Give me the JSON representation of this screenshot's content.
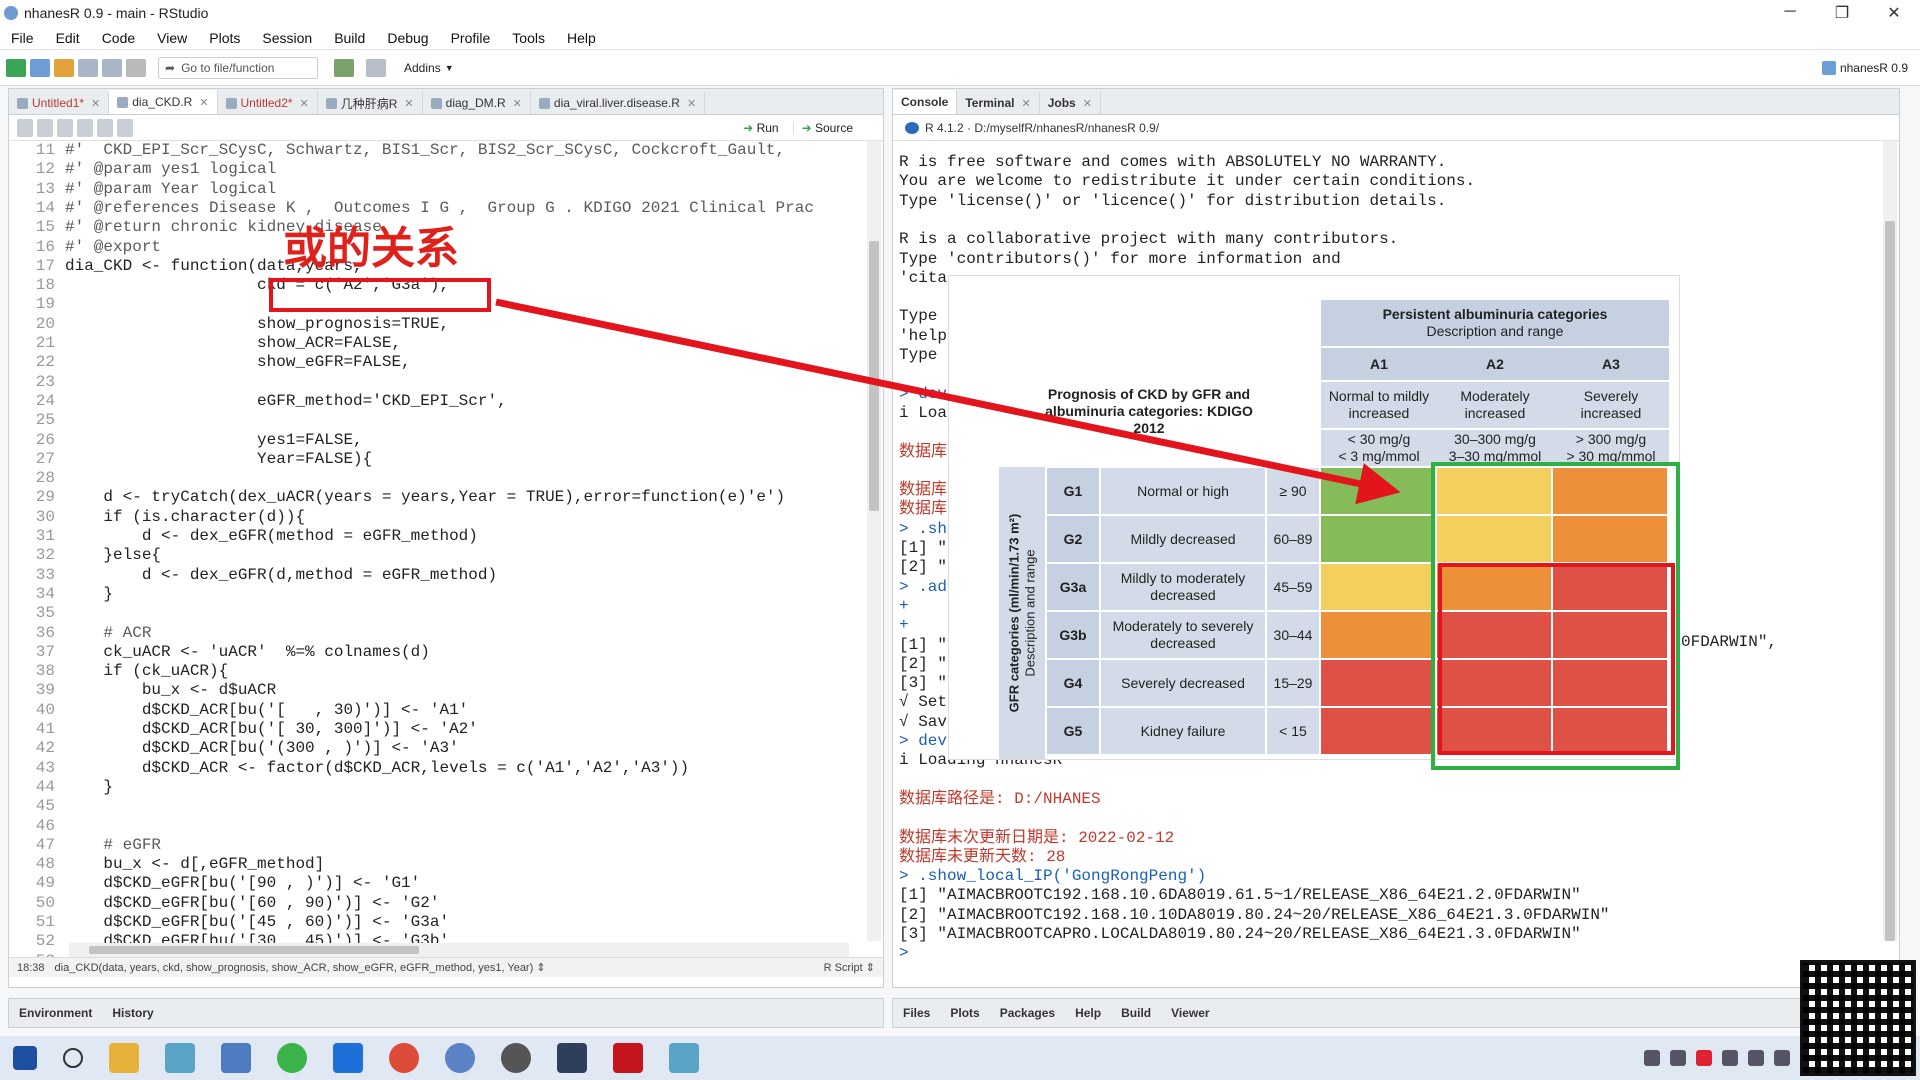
{
  "window": {
    "title": "nhanesR 0.9 - main - RStudio",
    "controls": [
      "─",
      "❐",
      "✕"
    ]
  },
  "menu": [
    "File",
    "Edit",
    "Code",
    "View",
    "Plots",
    "Session",
    "Build",
    "Debug",
    "Profile",
    "Tools",
    "Help"
  ],
  "toolbar": {
    "goto_placeholder": "Go to file/function",
    "addins": "Addins",
    "project": "nhanesR 0.9"
  },
  "editor": {
    "tabs": [
      {
        "label": "Untitled1*",
        "modified": true
      },
      {
        "label": "dia_CKD.R",
        "active": true
      },
      {
        "label": "Untitled2*",
        "modified": true
      },
      {
        "label": "几种肝病R"
      },
      {
        "label": "diag_DM.R"
      },
      {
        "label": "dia_viral.liver.disease.R"
      }
    ],
    "run_label": "Run",
    "source_label": "Source",
    "lines": [
      [
        "11",
        "#'  CKD_EPI_Scr_SCysC, Schwartz, BIS1_Scr, BIS2_Scr_SCysC, Cockcroft_Gault,"
      ],
      [
        "12",
        "#' @param yes1 logical"
      ],
      [
        "13",
        "#' @param Year logical"
      ],
      [
        "14",
        "#' @references Disease K ,  Outcomes I G ,  Group G . KDIGO 2021 Clinical Prac"
      ],
      [
        "15",
        "#' @return chronic kidney disease"
      ],
      [
        "16",
        "#' @export"
      ],
      [
        "17",
        "dia_CKD <- function(data,years,"
      ],
      [
        "18",
        "                    ckd = c('A2','G3a'),"
      ],
      [
        "19",
        ""
      ],
      [
        "20",
        "                    show_prognosis=TRUE,"
      ],
      [
        "21",
        "                    show_ACR=FALSE,"
      ],
      [
        "22",
        "                    show_eGFR=FALSE,"
      ],
      [
        "23",
        ""
      ],
      [
        "24",
        "                    eGFR_method='CKD_EPI_Scr',"
      ],
      [
        "25",
        ""
      ],
      [
        "26",
        "                    yes1=FALSE,"
      ],
      [
        "27",
        "                    Year=FALSE){"
      ],
      [
        "28",
        ""
      ],
      [
        "29",
        "    d <- tryCatch(dex_uACR(years = years,Year = TRUE),error=function(e)'e')"
      ],
      [
        "30",
        "    if (is.character(d)){"
      ],
      [
        "31",
        "        d <- dex_eGFR(method = eGFR_method)"
      ],
      [
        "32",
        "    }else{"
      ],
      [
        "33",
        "        d <- dex_eGFR(d,method = eGFR_method)"
      ],
      [
        "34",
        "    }"
      ],
      [
        "35",
        ""
      ],
      [
        "36",
        "    # ACR"
      ],
      [
        "37",
        "    ck_uACR <- 'uACR'  %=% colnames(d)"
      ],
      [
        "38",
        "    if (ck_uACR){"
      ],
      [
        "39",
        "        bu_x <- d$uACR"
      ],
      [
        "40",
        "        d$CKD_ACR[bu('[   , 30)')] <- 'A1'"
      ],
      [
        "41",
        "        d$CKD_ACR[bu('[ 30, 300]')] <- 'A2'"
      ],
      [
        "42",
        "        d$CKD_ACR[bu('(300 , )')] <- 'A3'"
      ],
      [
        "43",
        "        d$CKD_ACR <- factor(d$CKD_ACR,levels = c('A1','A2','A3'))"
      ],
      [
        "44",
        "    }"
      ],
      [
        "45",
        ""
      ],
      [
        "46",
        ""
      ],
      [
        "47",
        "    # eGFR"
      ],
      [
        "48",
        "    bu_x <- d[,eGFR_method]"
      ],
      [
        "49",
        "    d$CKD_eGFR[bu('[90 , )')] <- 'G1'"
      ],
      [
        "50",
        "    d$CKD_eGFR[bu('[60 , 90)')] <- 'G2'"
      ],
      [
        "51",
        "    d$CKD_eGFR[bu('[45 , 60)')] <- 'G3a'"
      ],
      [
        "52",
        "    d$CKD_eGFR[bu('[30 , 45)')] <- 'G3b'"
      ],
      [
        "53",
        ""
      ]
    ],
    "status_pos": "18:38",
    "status_fn": "dia_CKD(data, years, ckd, show_prognosis, show_ACR, show_eGFR, eGFR_method, yes1, Year) ⇕",
    "status_type": "R Script ⇕"
  },
  "env_tabs": [
    "Environment",
    "History"
  ],
  "console": {
    "tabs": [
      "Console",
      "Terminal",
      "Jobs"
    ],
    "path": "R 4.1.2 · D:/myselfR/nhanesR/nhanesR 0.9/",
    "lines": [
      {
        "t": "R is free software and comes with ABSOLUTELY NO WARRANTY.",
        "c": ""
      },
      {
        "t": "You are welcome to redistribute it under certain conditions.",
        "c": ""
      },
      {
        "t": "Type 'license()' or 'licence()' for distribution details.",
        "c": ""
      },
      {
        "t": "",
        "c": ""
      },
      {
        "t": "R is a collaborative project with many contributors.",
        "c": ""
      },
      {
        "t": "Type 'contributors()' for more information and",
        "c": ""
      },
      {
        "t": "'cita",
        "c": ""
      },
      {
        "t": "",
        "c": ""
      },
      {
        "t": "Type",
        "c": ""
      },
      {
        "t": "'help",
        "c": ""
      },
      {
        "t": "Type",
        "c": ""
      },
      {
        "t": "",
        "c": ""
      },
      {
        "t": "> dev",
        "c": "blu"
      },
      {
        "t": "i Loa",
        "c": ""
      },
      {
        "t": "",
        "c": ""
      },
      {
        "t": "数据库",
        "c": "red"
      },
      {
        "t": "",
        "c": ""
      },
      {
        "t": "数据库",
        "c": "red"
      },
      {
        "t": "数据库",
        "c": "red"
      },
      {
        "t": "> .sh",
        "c": "blu"
      },
      {
        "t": "[1] \"",
        "c": ""
      },
      {
        "t": "[2] \"",
        "c": ""
      },
      {
        "t": "> .ad",
        "c": "blu"
      },
      {
        "t": "+",
        "c": "blu"
      },
      {
        "t": "+",
        "c": "blu"
      },
      {
        "t": "[1] \"",
        "c": ""
      },
      {
        "t": "[2] \"",
        "c": ""
      },
      {
        "t": "[3] \"",
        "c": ""
      },
      {
        "t": "√ Set",
        "c": ""
      },
      {
        "t": "√ Sav",
        "c": ""
      },
      {
        "t": "> dev",
        "c": "blu"
      },
      {
        "t": "i Loading nhanesR",
        "c": ""
      },
      {
        "t": "",
        "c": ""
      },
      {
        "t": "数据库路径是: D:/NHANES",
        "c": "red"
      },
      {
        "t": "",
        "c": ""
      },
      {
        "t": "数据库末次更新日期是: 2022-02-12",
        "c": "red"
      },
      {
        "t": "数据库未更新天数: 28",
        "c": "red"
      },
      {
        "t": "> .show_local_IP('GongRongPeng')",
        "c": "blu"
      },
      {
        "t": "[1] \"AIMACBROOTC192.168.10.6DA8019.61.5~1/RELEASE_X86_64E21.2.0FDARWIN\"",
        "c": ""
      },
      {
        "t": "[2] \"AIMACBROOTC192.168.10.10DA8019.80.24~20/RELEASE_X86_64E21.3.0FDARWIN\"",
        "c": ""
      },
      {
        "t": "[3] \"AIMACBROOTCAPRO.LOCALDA8019.80.24~20/RELEASE_X86_64E21.3.0FDARWIN\"",
        "c": ""
      },
      {
        "t": ">",
        "c": "blu"
      }
    ],
    "side_fragment": "0FDARWIN\","
  },
  "files_tabs": [
    "Files",
    "Plots",
    "Packages",
    "Help",
    "Build",
    "Viewer"
  ],
  "kdigo": {
    "title": "Prognosis of CKD by GFR and albuminuria categories: KDIGO 2012",
    "persist_title": "Persistent albuminuria categories",
    "persist_sub": "Description and range",
    "cols": [
      {
        "code": "A1",
        "desc": "Normal to mildly increased",
        "range": "< 30 mg/g\n< 3 mg/mmol"
      },
      {
        "code": "A2",
        "desc": "Moderately increased",
        "range": "30–300 mg/g\n3–30 mg/mmol"
      },
      {
        "code": "A3",
        "desc": "Severely increased",
        "range": "> 300 mg/g\n> 30 mg/mmol"
      }
    ],
    "side_label_1": "GFR categories (ml/min/1.73 m²)",
    "side_label_2": "Description and range",
    "rows": [
      {
        "code": "G1",
        "desc": "Normal or high",
        "range": "≥ 90",
        "colors": [
          "#86bb5a",
          "#f3cf5d",
          "#ee8f3a"
        ]
      },
      {
        "code": "G2",
        "desc": "Mildly decreased",
        "range": "60–89",
        "colors": [
          "#86bb5a",
          "#f3cf5d",
          "#ee8f3a"
        ]
      },
      {
        "code": "G3a",
        "desc": "Mildly to moderately decreased",
        "range": "45–59",
        "colors": [
          "#f3cf5d",
          "#ee8f3a",
          "#df5146"
        ]
      },
      {
        "code": "G3b",
        "desc": "Moderately to severely decreased",
        "range": "30–44",
        "colors": [
          "#ee8f3a",
          "#df5146",
          "#df5146"
        ]
      },
      {
        "code": "G4",
        "desc": "Severely decreased",
        "range": "15–29",
        "colors": [
          "#df5146",
          "#df5146",
          "#df5146"
        ]
      },
      {
        "code": "G5",
        "desc": "Kidney failure",
        "range": "< 15",
        "colors": [
          "#df5146",
          "#df5146",
          "#df5146"
        ]
      }
    ]
  },
  "annotation": {
    "text": "或的关系"
  }
}
